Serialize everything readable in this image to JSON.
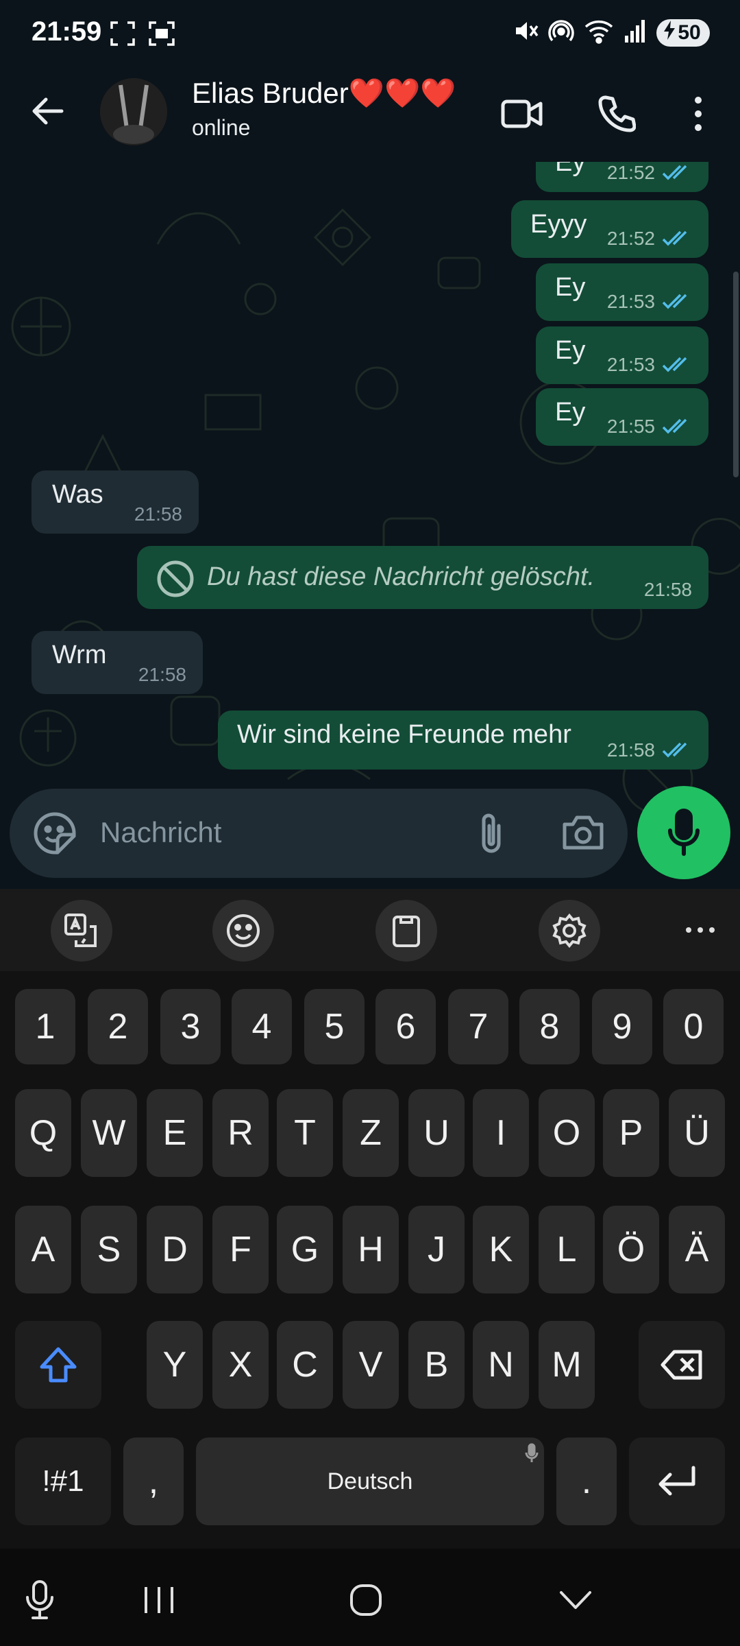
{
  "status_bar": {
    "time": "21:59",
    "battery": "50"
  },
  "header": {
    "contact_name": "Elias Bruder❤️❤️❤️",
    "contact_status": "online"
  },
  "messages": [
    {
      "direction": "out",
      "text": "Ey",
      "time": "21:52",
      "read": true
    },
    {
      "direction": "out",
      "text": "Eyyy",
      "time": "21:52",
      "read": true
    },
    {
      "direction": "out",
      "text": "Ey",
      "time": "21:53",
      "read": true
    },
    {
      "direction": "out",
      "text": "Ey",
      "time": "21:53",
      "read": true
    },
    {
      "direction": "out",
      "text": "Ey",
      "time": "21:55",
      "read": true
    },
    {
      "direction": "in",
      "text": "Was",
      "time": "21:58"
    },
    {
      "direction": "out",
      "text": "Du hast diese Nachricht gelöscht.",
      "time": "21:58",
      "deleted": true
    },
    {
      "direction": "in",
      "text": "Wrm",
      "time": "21:58"
    },
    {
      "direction": "out",
      "text": "Wir sind keine Freunde mehr",
      "time": "21:58",
      "read": true
    }
  ],
  "composer": {
    "placeholder": "Nachricht"
  },
  "keyboard": {
    "number_row": [
      "1",
      "2",
      "3",
      "4",
      "5",
      "6",
      "7",
      "8",
      "9",
      "0"
    ],
    "row1": [
      "Q",
      "W",
      "E",
      "R",
      "T",
      "Z",
      "U",
      "I",
      "O",
      "P",
      "Ü"
    ],
    "row2": [
      "A",
      "S",
      "D",
      "F",
      "G",
      "H",
      "J",
      "K",
      "L",
      "Ö",
      "Ä"
    ],
    "row3": [
      "Y",
      "X",
      "C",
      "V",
      "B",
      "N",
      "M"
    ],
    "symbols_key": "!#1",
    "comma_key": ",",
    "space_label": "Deutsch",
    "period_key": "."
  },
  "colors": {
    "outgoing_bubble": "#134d37",
    "incoming_bubble": "#1f2c34",
    "read_ticks": "#53bdeb",
    "mic_button": "#21c063",
    "shift_accent": "#4a8cff"
  }
}
